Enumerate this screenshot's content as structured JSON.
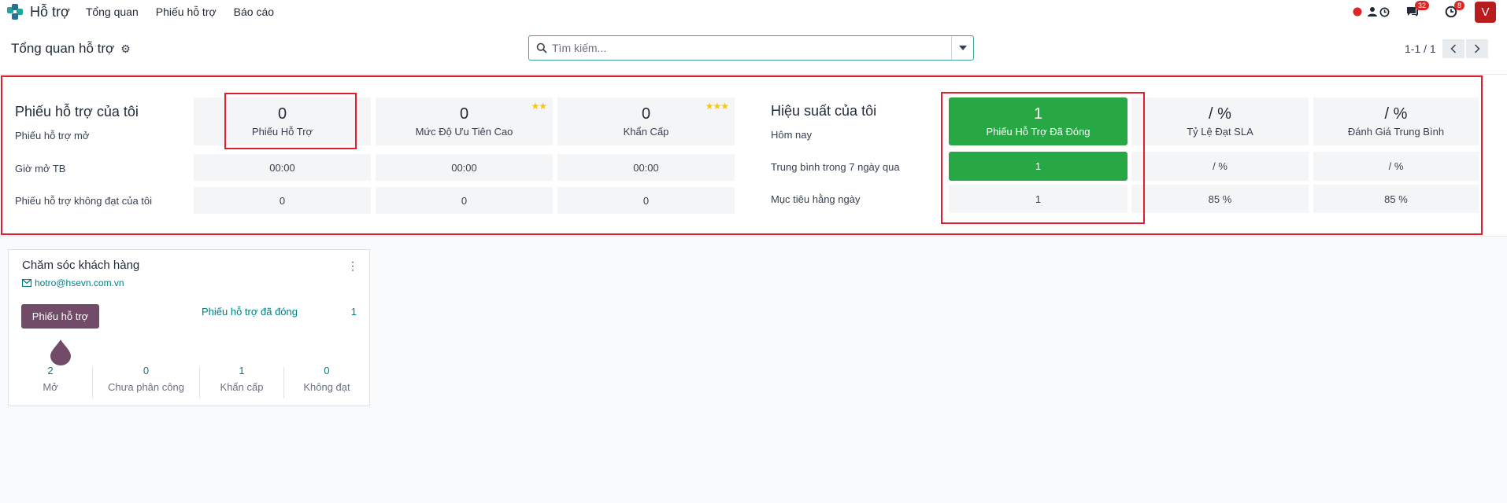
{
  "navbar": {
    "app_name": "Hỗ trợ",
    "menu": [
      "Tổng quan",
      "Phiếu hỗ trợ",
      "Báo cáo"
    ],
    "messages_badge": "32",
    "activities_badge": "8",
    "avatar_initial": "V"
  },
  "control_panel": {
    "title": "Tổng quan hỗ trợ",
    "search_placeholder": "Tìm kiếm...",
    "pager": "1-1 / 1"
  },
  "my_tickets": {
    "title": "Phiếu hỗ trợ của tôi",
    "row_labels": [
      "Phiếu hỗ trợ mở",
      "Giờ mở TB",
      "Phiếu hỗ trợ không đạt của tôi"
    ],
    "columns": [
      {
        "value": "0",
        "label": "Phiếu Hỗ Trợ",
        "stars": "",
        "avg_open": "00:00",
        "failed": "0"
      },
      {
        "value": "0",
        "label": "Mức Độ Ưu Tiên Cao",
        "stars": "★★",
        "avg_open": "00:00",
        "failed": "0"
      },
      {
        "value": "0",
        "label": "Khẩn Cấp",
        "stars": "★★★",
        "avg_open": "00:00",
        "failed": "0"
      }
    ]
  },
  "my_performance": {
    "title": "Hiệu suất của tôi",
    "row_labels": [
      "Hôm nay",
      "Trung bình trong 7 ngày qua",
      "Mục tiêu hằng ngày"
    ],
    "columns": [
      {
        "value": "1",
        "label": "Phiếu Hỗ Trợ Đã Đóng",
        "avg7": "1",
        "target": "1"
      },
      {
        "value": "/ %",
        "label": "Tỷ Lệ Đạt SLA",
        "avg7": "/ %",
        "target": "85 %"
      },
      {
        "value": "/ %",
        "label": "Đánh Giá Trung Bình",
        "avg7": "/ %",
        "target": "85 %"
      }
    ]
  },
  "team_card": {
    "name": "Chăm sóc khách hàng",
    "email": "hotro@hsevn.com.vn",
    "button_label": "Phiếu hỗ trợ",
    "closed_label": "Phiếu hỗ trợ đã đóng",
    "closed_count": "1",
    "stats": [
      {
        "value": "2",
        "label": "Mở"
      },
      {
        "value": "0",
        "label": "Chưa phân công"
      },
      {
        "value": "1",
        "label": "Khẩn cấp"
      },
      {
        "value": "0",
        "label": "Không đạt"
      }
    ]
  },
  "colors": {
    "brand_purple": "#714b67",
    "link_teal": "#017e84",
    "success_green": "#28a745",
    "highlight_red": "#e11d2e"
  }
}
